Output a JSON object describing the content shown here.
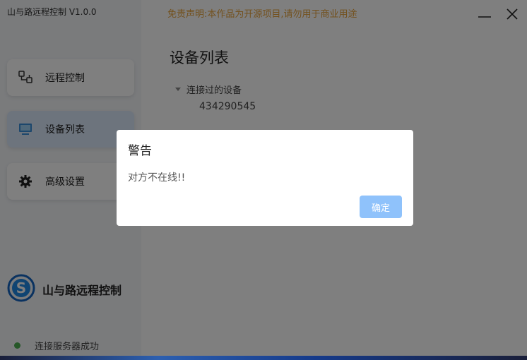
{
  "window": {
    "title": "山与路远程控制 V1.0.0",
    "disclaimer": "免责声明:本作品为开源项目,请勿用于商业用途",
    "disclaimer_color": "#e6a23c"
  },
  "sidebar": {
    "items": [
      {
        "label": "远程控制",
        "icon": "remote-control-icon",
        "active": false
      },
      {
        "label": "设备列表",
        "icon": "monitor-icon",
        "active": true
      },
      {
        "label": "高级设置",
        "icon": "gear-icon",
        "active": false
      }
    ],
    "brand_name": "山与路远程控制",
    "status_text": "连接服务器成功",
    "status_color": "#4caf50"
  },
  "main": {
    "title": "设备列表",
    "tree": {
      "group_label": "连接过的设备",
      "devices": [
        "434290545"
      ]
    }
  },
  "dialog": {
    "title": "警告",
    "message": "对方不在线!!",
    "confirm_label": "确定",
    "confirm_color": "#8fc2fb"
  }
}
